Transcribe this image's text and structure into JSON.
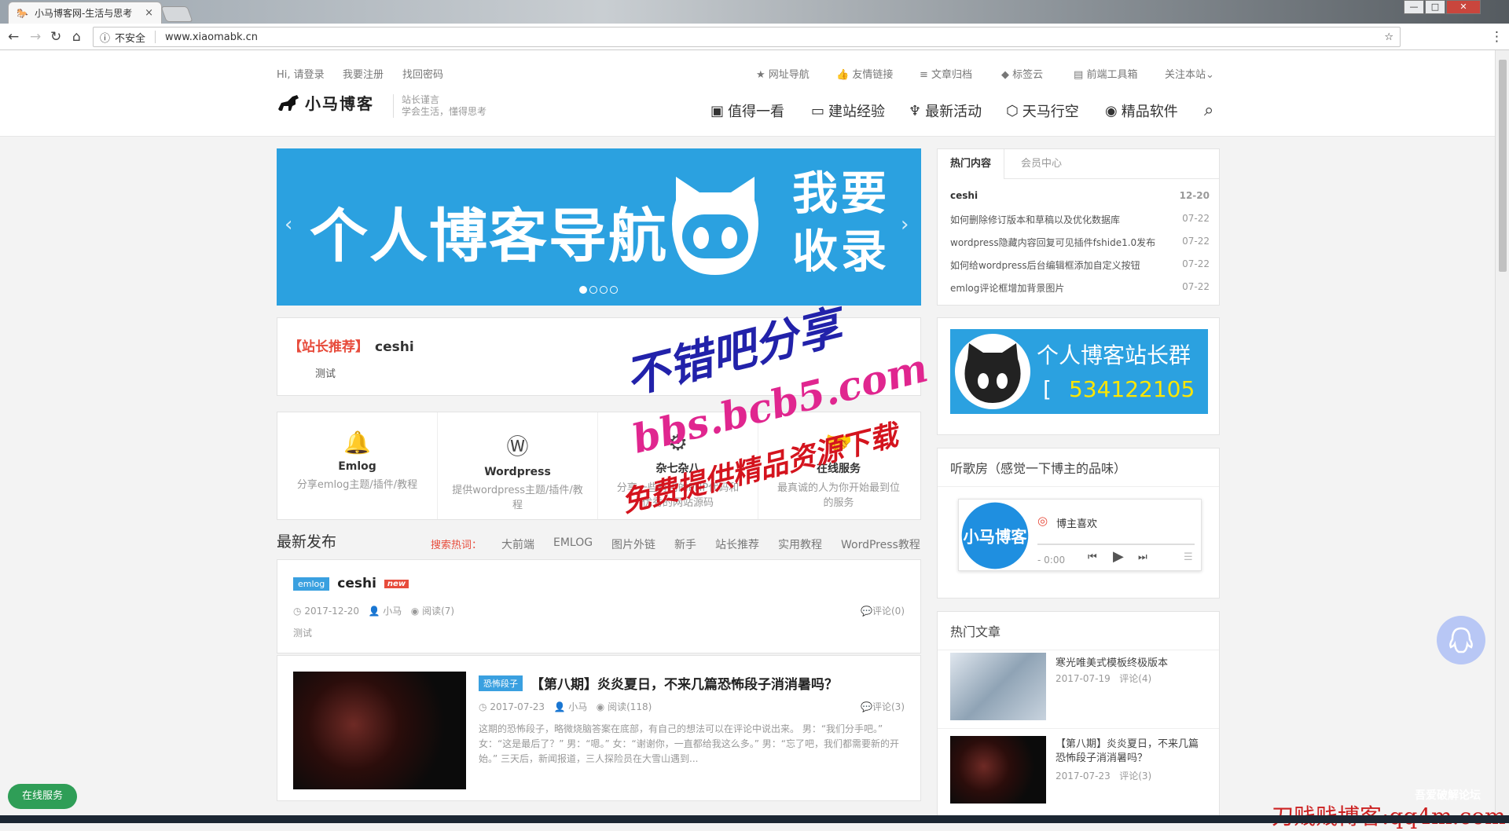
{
  "browser": {
    "tab_title": "小马博客网-生活与思考",
    "tab_close": "×",
    "security": "不安全",
    "url": "www.xiaomabk.cn",
    "back": "←",
    "forward": "→",
    "reload": "↻",
    "home": "⌂",
    "info": "ⓘ",
    "star": "☆",
    "menu": "⋮",
    "win_min": "—",
    "win_max": "□",
    "win_close": "✕"
  },
  "topbar": {
    "login": "Hi, 请登录",
    "register": "我要注册",
    "forgot": "找回密码",
    "links": [
      {
        "label": "网址导航",
        "icon": "★"
      },
      {
        "label": "友情链接",
        "icon": "👍"
      },
      {
        "label": "文章归档",
        "icon": "≡"
      },
      {
        "label": "标签云",
        "icon": "◆"
      },
      {
        "label": "前端工具箱",
        "icon": "▤"
      }
    ],
    "follow": "关注本站",
    "follow_caret": "⌄"
  },
  "logo": {
    "name": "小马博客",
    "slogan1": "站长谨言",
    "slogan2": "学会生活，懂得思考"
  },
  "mainnav": [
    {
      "label": "值得一看",
      "icon": "▣"
    },
    {
      "label": "建站经验",
      "icon": "▭"
    },
    {
      "label": "最新活动",
      "icon": "♆"
    },
    {
      "label": "天马行空",
      "icon": "⬡"
    },
    {
      "label": "精品软件",
      "icon": "◉"
    }
  ],
  "search_icon": "⌕",
  "banner": {
    "text": "个人博客导航",
    "side1": "我要",
    "side2": "收录",
    "prev": "‹",
    "next": "›"
  },
  "recommend": {
    "tag": "【站长推荐】",
    "title": "ceshi",
    "desc": "测试"
  },
  "features": [
    {
      "icon": "🔔",
      "title": "Emlog",
      "desc": "分享emlog主题/插件/教程"
    },
    {
      "icon": "Ⓦ",
      "title": "Wordpress",
      "desc": "提供wordpress主题/插件/教程"
    },
    {
      "icon": "⚙",
      "title": "杂七杂八",
      "desc": "分享一些有用的PHP代码和优秀的网站源码"
    },
    {
      "icon": "🤝",
      "title": "在线服务",
      "desc": "最真诚的人为你开始最到位的服务"
    }
  ],
  "latest": {
    "heading": "最新发布",
    "hot_label": "搜索热词：",
    "keywords": [
      "大前端",
      "EMLOG",
      "图片外链",
      "新手",
      "站长推荐",
      "实用教程",
      "WordPress教程"
    ]
  },
  "posts": [
    {
      "cat": "emlog",
      "title": "ceshi",
      "badge": "new",
      "date": "2017-12-20",
      "author": "小马",
      "views": "阅读(7)",
      "comments": "评论(0)",
      "excerpt": "测试"
    },
    {
      "cat": "恐怖段子",
      "title": "【第八期】炎炎夏日，不来几篇恐怖段子消消暑吗？",
      "date": "2017-07-23",
      "author": "小马",
      "views": "阅读(118)",
      "comments": "评论(3)",
      "excerpt": "这期的恐怖段子，略微烧脑答案在底部，有自己的想法可以在评论中说出来。 男：“我们分手吧。” 女：“这是最后了？” 男：“嗯。” 女：“谢谢你，一直都给我这么多。” 男：“忘了吧，我们都需要新的开始。” 三天后，新闻报道，三人探险员在大雪山遇到..."
    }
  ],
  "sidebar": {
    "tabs": [
      "热门内容",
      "会员中心"
    ],
    "hot": [
      {
        "title": "ceshi",
        "date": "12-20"
      },
      {
        "title": "如何删除修订版本和草稿以及优化数据库",
        "date": "07-22"
      },
      {
        "title": "wordpress隐藏内容回复可见插件fshide1.0发布",
        "date": "07-22"
      },
      {
        "title": "如何给wordpress后台编辑框添加自定义按钮",
        "date": "07-22"
      },
      {
        "title": "emlog评论框增加背景图片",
        "date": "07-22"
      }
    ],
    "qq_group": {
      "title": "个人博客站长群",
      "number": "534122105",
      "lb": "[",
      "rb": "]"
    },
    "music": {
      "heading": "听歌房（感觉一下博主的品味）",
      "title": "博主喜欢",
      "time": "- 0:00",
      "cover": "小马博客",
      "prev": "⏮",
      "play": "▶",
      "next": "⏭",
      "list": "☰"
    },
    "hot_articles": {
      "heading": "热门文章",
      "items": [
        {
          "title": "寒光唯美式模板终极版本",
          "date": "2017-07-19",
          "comments": "评论(4)"
        },
        {
          "title": "【第八期】炎炎夏日，不来几篇恐怖段子消消暑吗？",
          "date": "2017-07-23",
          "comments": "评论(3)"
        }
      ]
    }
  },
  "online_service": "在线服务",
  "watermarks": {
    "w1": "不错吧分享",
    "w2": "bbs.bcb5.com",
    "w3": "免费提供精品资源下载",
    "w4": "刀贱贱博客:qq4m.com",
    "w5": "吾爱破解论坛"
  },
  "colors": {
    "accent": "#2ba1e0",
    "red": "#e74c3c",
    "green": "#2f9e57"
  }
}
